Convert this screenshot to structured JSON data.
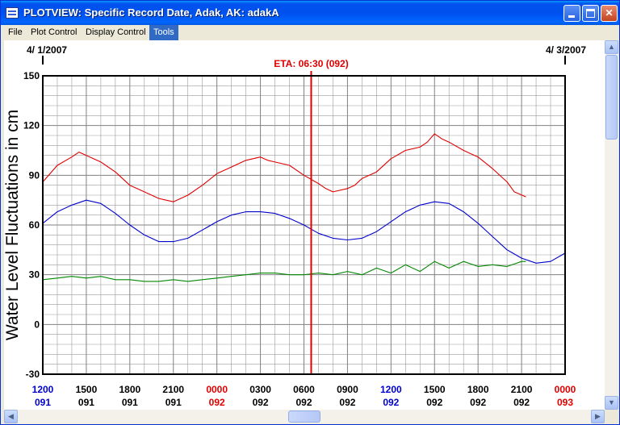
{
  "window": {
    "title": "PLOTVIEW: Specific Record Date, Adak, AK: adakA",
    "minimize_icon": "minimize-icon",
    "maximize_icon": "maximize-icon",
    "close_glyph": "✕"
  },
  "menu": {
    "items": [
      {
        "label": "File",
        "active": false
      },
      {
        "label": "Plot Control",
        "active": false
      },
      {
        "label": "Display Control",
        "active": false
      },
      {
        "label": "Tools",
        "active": true
      }
    ]
  },
  "scrollbars": {
    "up": "▲",
    "down": "▼",
    "left": "◀",
    "right": "▶"
  },
  "colors": {
    "observed": "#e00000",
    "predicted": "#0000cc",
    "residual": "#008800",
    "eta": "#e00000",
    "grid": "#9a9a9a",
    "blue_label": "#0000cc",
    "red_label": "#e00000"
  },
  "chart_data": {
    "type": "line",
    "title": "",
    "ylabel": "Water Level Fluctuations in cm",
    "xlabel": "",
    "ylim": [
      -30,
      150
    ],
    "yticks": [
      150,
      120,
      90,
      60,
      30,
      0,
      -30
    ],
    "grid": true,
    "x_units": "hours from 2007-04-01 12:00",
    "xlim": [
      0,
      36
    ],
    "start_date_label": "4/ 1/2007",
    "end_date_label": "4/ 3/2007",
    "eta_label": "ETA: 06:30 (092)",
    "eta_x": 18.5,
    "xticks": [
      {
        "x": 0,
        "time": "1200",
        "day": "091",
        "color": "blue"
      },
      {
        "x": 3,
        "time": "1500",
        "day": "091",
        "color": "black"
      },
      {
        "x": 6,
        "time": "1800",
        "day": "091",
        "color": "black"
      },
      {
        "x": 9,
        "time": "2100",
        "day": "091",
        "color": "black"
      },
      {
        "x": 12,
        "time": "0000",
        "day": "092",
        "color": "red"
      },
      {
        "x": 15,
        "time": "0300",
        "day": "092",
        "color": "black"
      },
      {
        "x": 18,
        "time": "0600",
        "day": "092",
        "color": "black"
      },
      {
        "x": 21,
        "time": "0900",
        "day": "092",
        "color": "black"
      },
      {
        "x": 24,
        "time": "1200",
        "day": "092",
        "color": "blue"
      },
      {
        "x": 27,
        "time": "1500",
        "day": "092",
        "color": "black"
      },
      {
        "x": 30,
        "time": "1800",
        "day": "092",
        "color": "black"
      },
      {
        "x": 33,
        "time": "2100",
        "day": "092",
        "color": "black"
      },
      {
        "x": 36,
        "time": "0000",
        "day": "093",
        "color": "red"
      }
    ],
    "series": [
      {
        "key": "observed",
        "color": "#e00000",
        "x": [
          0,
          1,
          2,
          2.5,
          3,
          4,
          5,
          6,
          7,
          8,
          8.5,
          9,
          9.5,
          10,
          11,
          12,
          13,
          14,
          15,
          15.5,
          16,
          17,
          18,
          19,
          19.5,
          20,
          21,
          21.5,
          22,
          23,
          24,
          25,
          26,
          26.5,
          27,
          27.5,
          28,
          29,
          30,
          31,
          32,
          32.5,
          33.3
        ],
        "y": [
          86,
          96,
          101,
          104,
          102,
          98,
          92,
          84,
          80,
          76,
          75,
          74,
          76,
          78,
          84,
          91,
          95,
          99,
          101,
          99,
          98,
          96,
          90,
          85,
          82,
          80,
          82,
          84,
          88,
          92,
          100,
          105,
          107,
          110,
          115,
          112,
          110,
          105,
          101,
          94,
          86,
          80,
          77
        ]
      },
      {
        "key": "predicted",
        "color": "#0000cc",
        "x": [
          0,
          1,
          2,
          3,
          4,
          5,
          6,
          7,
          8,
          9,
          10,
          11,
          12,
          13,
          14,
          15,
          16,
          17,
          18,
          19,
          20,
          21,
          22,
          23,
          24,
          25,
          26,
          27,
          28,
          29,
          30,
          31,
          32,
          33,
          34,
          35,
          36
        ],
        "y": [
          61,
          68,
          72,
          75,
          73,
          67,
          60,
          54,
          50,
          50,
          52,
          57,
          62,
          66,
          68,
          68,
          67,
          64,
          60,
          55,
          52,
          51,
          52,
          56,
          62,
          68,
          72,
          74,
          73,
          68,
          61,
          53,
          45,
          40,
          37,
          38,
          43
        ]
      },
      {
        "key": "residual",
        "color": "#008800",
        "x": [
          0,
          1,
          2,
          3,
          4,
          5,
          6,
          7,
          8,
          9,
          10,
          11,
          12,
          13,
          14,
          15,
          16,
          17,
          18,
          19,
          20,
          21,
          22,
          23,
          24,
          25,
          26,
          27,
          28,
          29,
          30,
          31,
          32,
          33,
          33.3
        ],
        "y": [
          27,
          28,
          29,
          28,
          29,
          27,
          27,
          26,
          26,
          27,
          26,
          27,
          28,
          29,
          30,
          31,
          31,
          30,
          30,
          31,
          30,
          32,
          30,
          34,
          31,
          36,
          32,
          38,
          34,
          38,
          35,
          36,
          35,
          38,
          38
        ]
      }
    ]
  }
}
